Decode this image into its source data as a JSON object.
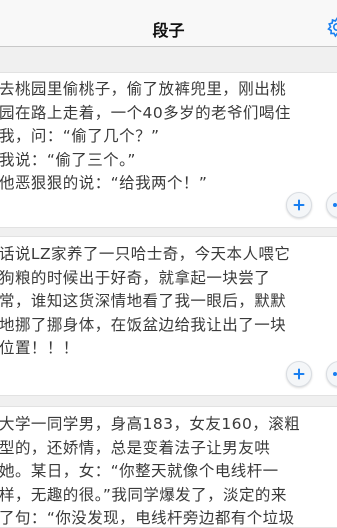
{
  "status_bar": {
    "carrier": "",
    "time": ""
  },
  "nav": {
    "title": "段子",
    "settings_icon": "gear-icon"
  },
  "jokes": [
    {
      "text": "去桃园里偷桃子，偷了放裤兜里，刚出桃\n园在路上走着，一个40多岁的老爷们喝住\n我，问：“偷了几个？”\n我说：“偷了三个。”\n他恶狠狠的说：“给我两个！”"
    },
    {
      "text": "话说LZ家养了一只哈士奇，今天本人喂它\n狗粮的时候出于好奇，就拿起一块尝了\n常，谁知这货深情地看了我一眼后，默默\n地挪了挪身体，在饭盆边给我让出了一块\n位置！！！"
    },
    {
      "text": "大学一同学男，身高183，女友160，滚粗\n型的，还娇情，总是变着法子让男友哄\n她。某日，女：“你整天就像个电线杆一\n样，无趣的很。”我同学爆发了，淡定的来\n了句：“你没发现，电线杆旁边都有个垃圾"
    }
  ],
  "actions": {
    "add_icon": "plus-icon",
    "secondary_icon": "share-icon"
  },
  "colors": {
    "accent": "#1a7ff0",
    "background": "#f0f0f0",
    "card": "#ffffff",
    "text": "#3a3a3a"
  }
}
